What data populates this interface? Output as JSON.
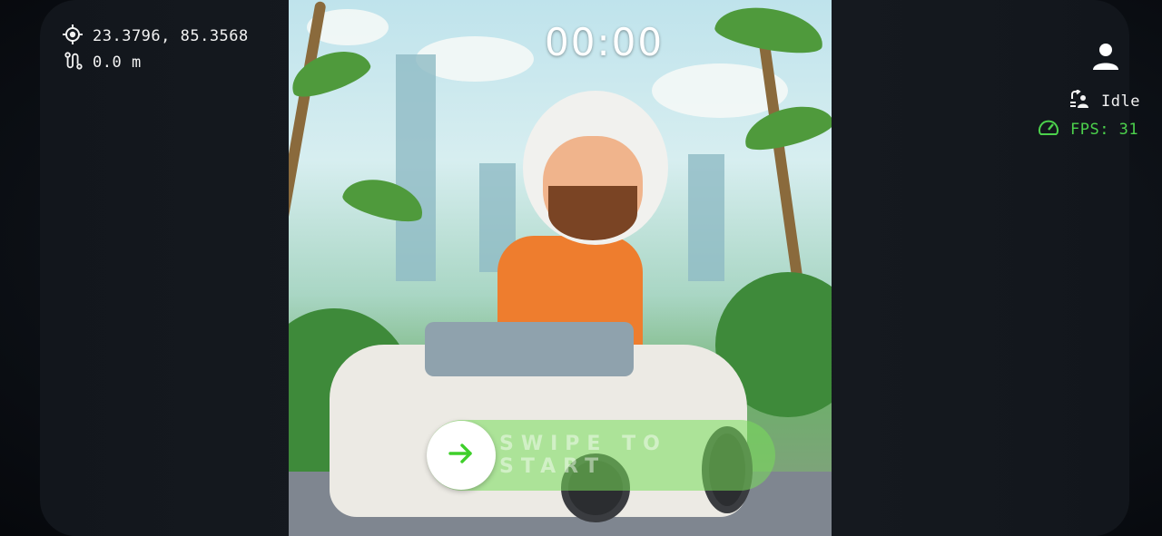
{
  "location": {
    "coordinates": "23.3796, 85.3568",
    "distance": "0.0 m",
    "icon": "gps-crosshair-icon",
    "distance_icon": "route-icon"
  },
  "recording": {
    "timer": "00:00"
  },
  "status": {
    "profile_icon": "person-icon",
    "state_label": "Idle",
    "state_icon": "mode-switch-icon",
    "fps_label": "FPS: 31",
    "fps_icon": "speedometer-icon",
    "fps_color": "#4cd14c"
  },
  "controls": {
    "swipe_label": "SWIPE TO START",
    "swipe_icon": "arrow-right-icon",
    "accent_color": "#3ecf2a"
  }
}
